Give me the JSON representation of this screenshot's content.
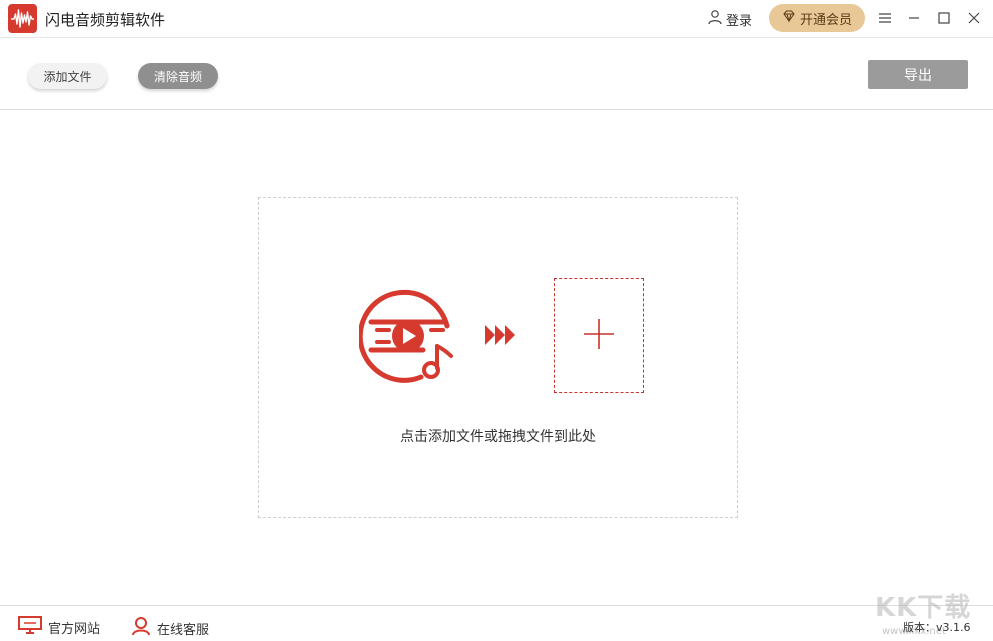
{
  "titlebar": {
    "app_title": "闪电音频剪辑软件",
    "login_label": "登录",
    "vip_label": "开通会员"
  },
  "toolbar": {
    "add_file_label": "添加文件",
    "clear_audio_label": "清除音频",
    "export_label": "导出"
  },
  "dropzone": {
    "hint": "点击添加文件或拖拽文件到此处"
  },
  "statusbar": {
    "official_site_label": "官方网站",
    "online_service_label": "在线客服",
    "version_label": "版本：v3.1.6"
  },
  "watermark": {
    "text": "KK下载",
    "sub": "www.kkx.net"
  },
  "colors": {
    "accent_red": "#d63a2f",
    "vip_gold": "#e8c897",
    "export_gray": "#9b9b9b"
  },
  "icons": {
    "app_logo": "waveform-logo-icon",
    "login": "user-icon",
    "vip": "diamond-icon",
    "menu": "menu-icon",
    "minimize": "minimize-icon",
    "maximize": "maximize-icon",
    "close": "close-icon",
    "media": "video-music-icon",
    "arrows": "fast-forward-icon",
    "plus": "plus-icon",
    "website": "monitor-icon",
    "service": "headset-user-icon"
  }
}
